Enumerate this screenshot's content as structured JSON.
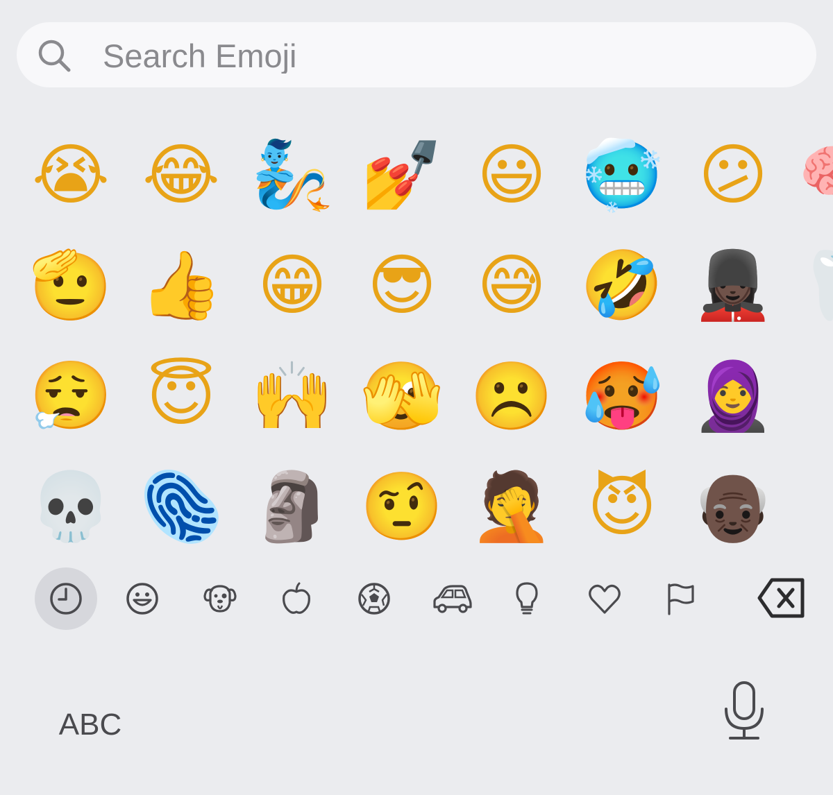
{
  "search": {
    "placeholder": "Search Emoji"
  },
  "emoji_rows": [
    [
      "😭",
      "😂",
      "🧞",
      "💅",
      "😃",
      "🥶",
      "😕",
      "🧠"
    ],
    [
      "🫡",
      "👍",
      "😁",
      "😎",
      "😅",
      "🤣",
      "💂🏿‍♀️",
      "🦷"
    ],
    [
      "😮‍💨",
      "😇",
      "🙌",
      "🫣",
      "☹️",
      "🥵",
      "🧕"
    ],
    [
      "💀",
      "🫆",
      "🗿",
      "🤨",
      "🤦",
      "😈",
      "👴🏿"
    ]
  ],
  "categories": [
    {
      "name": "recent",
      "icon": "clock-icon",
      "selected": true
    },
    {
      "name": "smileys",
      "icon": "smiley-icon",
      "selected": false
    },
    {
      "name": "animals",
      "icon": "dog-icon",
      "selected": false
    },
    {
      "name": "food",
      "icon": "apple-icon",
      "selected": false
    },
    {
      "name": "activity",
      "icon": "soccer-ball-icon",
      "selected": false
    },
    {
      "name": "travel",
      "icon": "car-icon",
      "selected": false
    },
    {
      "name": "objects",
      "icon": "lightbulb-icon",
      "selected": false
    },
    {
      "name": "symbols",
      "icon": "heart-icon",
      "selected": false
    },
    {
      "name": "flags",
      "icon": "flag-icon",
      "selected": false
    }
  ],
  "bottom": {
    "abc_label": "ABC"
  },
  "colors": {
    "background": "#ebecef",
    "search_bg": "#f8f8fa",
    "icon_gray": "#4a4a4e",
    "selected_bg": "#d6d7dc"
  }
}
